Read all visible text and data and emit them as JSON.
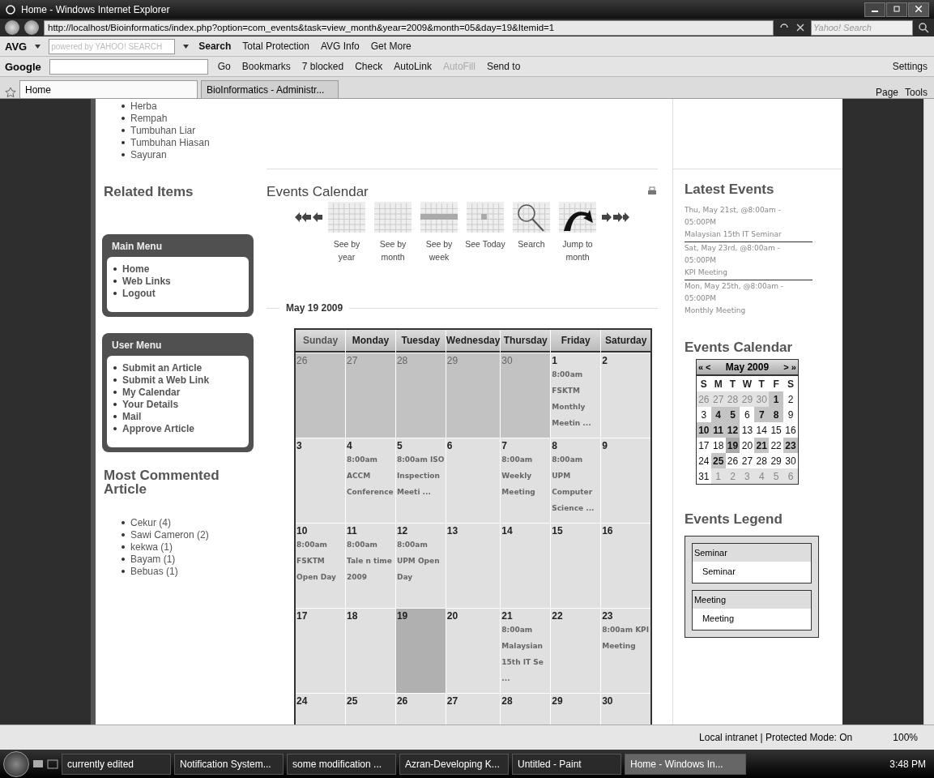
{
  "window": {
    "title": "Home - Windows Internet Explorer"
  },
  "address_bar": {
    "url": "http://localhost/Bioinformatics/index.php?option=com_events&task=view_month&year=2009&month=05&day=19&Itemid=1",
    "search_placeholder": "Yahoo! Search"
  },
  "avg_toolbar": {
    "brand": "AVG",
    "search_placeholder": "powered by YAHOO! SEARCH",
    "items": [
      "Search",
      "Total Protection",
      "AVG Info",
      "Get More"
    ]
  },
  "google_toolbar": {
    "brand": "Google",
    "items": [
      {
        "label": "Go",
        "disabled": false
      },
      {
        "label": "Bookmarks",
        "disabled": false
      },
      {
        "label": "7 blocked",
        "disabled": false
      },
      {
        "label": "Check",
        "disabled": false
      },
      {
        "label": "AutoLink",
        "disabled": false
      },
      {
        "label": "AutoFill",
        "disabled": true
      },
      {
        "label": "Send to",
        "disabled": false
      }
    ],
    "settings": "Settings"
  },
  "tabs": [
    {
      "label": "Home",
      "selected": true
    },
    {
      "label": "BioInformatics - Administr...",
      "selected": false
    }
  ],
  "command_bar": [
    "Page",
    "Tools"
  ],
  "left_column": {
    "categories": [
      "Herba",
      "Rempah",
      "Tumbuhan Liar",
      "Tumbuhan Hiasan",
      "Sayuran"
    ],
    "related_heading": "Related Items",
    "menus": [
      {
        "title": "Main Menu",
        "items": [
          "Home",
          "Web Links",
          "Logout"
        ]
      },
      {
        "title": "User Menu",
        "items": [
          "Submit an Article",
          "Submit a Web Link",
          "My Calendar",
          "Your Details",
          "Mail",
          "Approve Article"
        ]
      }
    ],
    "most_commented": {
      "heading": "Most Commented Article",
      "items": [
        "Cekur (4)",
        "Sawi Cameron (2)",
        "kekwa (1)",
        "Bayam (1)",
        "Bebuas (1)"
      ]
    }
  },
  "main": {
    "heading": "Events Calendar",
    "nav": [
      "See by year",
      "See by month",
      "See by week",
      "See Today",
      "Search",
      "Jump to month"
    ],
    "date": "May 19 2009",
    "calendar": {
      "columns": [
        "Sunday",
        "Monday",
        "Tuesday",
        "Wednesday",
        "Thursday",
        "Friday",
        "Saturday"
      ],
      "weeks": [
        [
          {
            "day": "26",
            "muted": true,
            "selected": false
          },
          {
            "day": "27",
            "muted": true,
            "selected": false
          },
          {
            "day": "28",
            "muted": true,
            "selected": false
          },
          {
            "day": "29",
            "muted": true,
            "selected": false
          },
          {
            "day": "30",
            "muted": true,
            "selected": false
          },
          {
            "day": "1",
            "muted": false,
            "selected": false,
            "event": "8:00am FSKTM Monthly Meetin ..."
          },
          {
            "day": "2",
            "muted": false,
            "selected": false
          }
        ],
        [
          {
            "day": "3",
            "muted": false,
            "selected": false
          },
          {
            "day": "4",
            "muted": false,
            "selected": false,
            "event": "8:00am ACCM Conference"
          },
          {
            "day": "5",
            "muted": false,
            "selected": false,
            "event": "8:00am ISO Inspection Meeti ..."
          },
          {
            "day": "6",
            "muted": false,
            "selected": false
          },
          {
            "day": "7",
            "muted": false,
            "selected": false,
            "event": "8:00am Weekly Meeting"
          },
          {
            "day": "8",
            "muted": false,
            "selected": false,
            "event": "8:00am UPM Computer Science ..."
          },
          {
            "day": "9",
            "muted": false,
            "selected": false
          }
        ],
        [
          {
            "day": "10",
            "muted": false,
            "selected": false,
            "event": "8:00am FSKTM Open Day"
          },
          {
            "day": "11",
            "muted": false,
            "selected": false,
            "event": "8:00am Tale n time 2009"
          },
          {
            "day": "12",
            "muted": false,
            "selected": false,
            "event": "8:00am UPM Open Day"
          },
          {
            "day": "13",
            "muted": false,
            "selected": false
          },
          {
            "day": "14",
            "muted": false,
            "selected": false
          },
          {
            "day": "15",
            "muted": false,
            "selected": false
          },
          {
            "day": "16",
            "muted": false,
            "selected": false
          }
        ],
        [
          {
            "day": "17",
            "muted": false,
            "selected": false
          },
          {
            "day": "18",
            "muted": false,
            "selected": false
          },
          {
            "day": "19",
            "muted": false,
            "selected": true
          },
          {
            "day": "20",
            "muted": false,
            "selected": false
          },
          {
            "day": "21",
            "muted": false,
            "selected": false,
            "event": "8:00am Malaysian 15th IT Se ..."
          },
          {
            "day": "22",
            "muted": false,
            "selected": false
          },
          {
            "day": "23",
            "muted": false,
            "selected": false,
            "event": "8:00am KPI Meeting"
          }
        ],
        [
          {
            "day": "24",
            "muted": false,
            "selected": false
          },
          {
            "day": "25",
            "muted": false,
            "selected": false
          },
          {
            "day": "26",
            "muted": false,
            "selected": false
          },
          {
            "day": "27",
            "muted": false,
            "selected": false
          },
          {
            "day": "28",
            "muted": false,
            "selected": false
          },
          {
            "day": "29",
            "muted": false,
            "selected": false
          },
          {
            "day": "30",
            "muted": false,
            "selected": false
          }
        ]
      ]
    }
  },
  "right_column": {
    "latest_heading": "Latest Events",
    "latest_events": [
      {
        "when": "Thu, May 21st, @8:00am - 05:00PM",
        "title": "Malaysian 15th IT Seminar"
      },
      {
        "when": "Sat, May 23rd, @8:00am - 05:00PM",
        "title": "KPI Meeting"
      },
      {
        "when": "Mon, May 25th, @8:00am - 05:00PM",
        "title": "Monthly Meeting"
      }
    ],
    "calendar_heading": "Events Calendar",
    "mini_calendar": {
      "month": "May 2009",
      "nav": [
        "«",
        "<",
        ">",
        "»"
      ],
      "weekdays": [
        "S",
        "M",
        "T",
        "W",
        "T",
        "F",
        "S"
      ],
      "weeks": [
        [
          {
            "day": "26",
            "muted": true,
            "has_event": false,
            "selected": false
          },
          {
            "day": "27",
            "muted": true,
            "has_event": false,
            "selected": false
          },
          {
            "day": "28",
            "muted": true,
            "has_event": false,
            "selected": false
          },
          {
            "day": "29",
            "muted": true,
            "has_event": false,
            "selected": false
          },
          {
            "day": "30",
            "muted": true,
            "has_event": false,
            "selected": false
          },
          {
            "day": "1",
            "muted": false,
            "has_event": true,
            "selected": false
          },
          {
            "day": "2",
            "muted": false,
            "has_event": false,
            "selected": false
          }
        ],
        [
          {
            "day": "3",
            "muted": false,
            "has_event": false,
            "selected": false
          },
          {
            "day": "4",
            "muted": false,
            "has_event": true,
            "selected": false
          },
          {
            "day": "5",
            "muted": false,
            "has_event": true,
            "selected": false
          },
          {
            "day": "6",
            "muted": false,
            "has_event": false,
            "selected": false
          },
          {
            "day": "7",
            "muted": false,
            "has_event": true,
            "selected": false
          },
          {
            "day": "8",
            "muted": false,
            "has_event": true,
            "selected": false
          },
          {
            "day": "9",
            "muted": false,
            "has_event": false,
            "selected": false
          }
        ],
        [
          {
            "day": "10",
            "muted": false,
            "has_event": true,
            "selected": false
          },
          {
            "day": "11",
            "muted": false,
            "has_event": true,
            "selected": false
          },
          {
            "day": "12",
            "muted": false,
            "has_event": true,
            "selected": false
          },
          {
            "day": "13",
            "muted": false,
            "has_event": false,
            "selected": false
          },
          {
            "day": "14",
            "muted": false,
            "has_event": false,
            "selected": false
          },
          {
            "day": "15",
            "muted": false,
            "has_event": false,
            "selected": false
          },
          {
            "day": "16",
            "muted": false,
            "has_event": false,
            "selected": false
          }
        ],
        [
          {
            "day": "17",
            "muted": false,
            "has_event": false,
            "selected": false
          },
          {
            "day": "18",
            "muted": false,
            "has_event": false,
            "selected": false
          },
          {
            "day": "19",
            "muted": false,
            "has_event": false,
            "selected": true
          },
          {
            "day": "20",
            "muted": false,
            "has_event": false,
            "selected": false
          },
          {
            "day": "21",
            "muted": false,
            "has_event": true,
            "selected": false
          },
          {
            "day": "22",
            "muted": false,
            "has_event": false,
            "selected": false
          },
          {
            "day": "23",
            "muted": false,
            "has_event": true,
            "selected": false
          }
        ],
        [
          {
            "day": "24",
            "muted": false,
            "has_event": false,
            "selected": false
          },
          {
            "day": "25",
            "muted": false,
            "has_event": true,
            "selected": false
          },
          {
            "day": "26",
            "muted": false,
            "has_event": false,
            "selected": false
          },
          {
            "day": "27",
            "muted": false,
            "has_event": false,
            "selected": false
          },
          {
            "day": "28",
            "muted": false,
            "has_event": false,
            "selected": false
          },
          {
            "day": "29",
            "muted": false,
            "has_event": false,
            "selected": false
          },
          {
            "day": "30",
            "muted": false,
            "has_event": false,
            "selected": false
          }
        ],
        [
          {
            "day": "31",
            "muted": false,
            "has_event": false,
            "selected": false
          },
          {
            "day": "1",
            "muted": true,
            "has_event": false,
            "selected": false
          },
          {
            "day": "2",
            "muted": true,
            "has_event": false,
            "selected": false
          },
          {
            "day": "3",
            "muted": true,
            "has_event": false,
            "selected": false
          },
          {
            "day": "4",
            "muted": true,
            "has_event": false,
            "selected": false
          },
          {
            "day": "5",
            "muted": true,
            "has_event": false,
            "selected": false
          },
          {
            "day": "6",
            "muted": true,
            "has_event": false,
            "selected": false
          }
        ]
      ]
    },
    "legend_heading": "Events Legend",
    "legend": [
      {
        "category": "Seminar",
        "description": "Seminar"
      },
      {
        "category": "Meeting",
        "description": "Meeting"
      }
    ]
  },
  "status_bar": {
    "zone": "Local intranet | Protected Mode: On",
    "zoom": "100%"
  },
  "taskbar": {
    "items": [
      {
        "label": "currently edited",
        "selected": false
      },
      {
        "label": "Notification System...",
        "selected": false
      },
      {
        "label": "some modification ...",
        "selected": false
      },
      {
        "label": "Azran-Developing K...",
        "selected": false
      },
      {
        "label": "Untitled - Paint",
        "selected": false
      },
      {
        "label": "Home - Windows In...",
        "selected": true
      }
    ],
    "clock": "3:48 PM"
  }
}
